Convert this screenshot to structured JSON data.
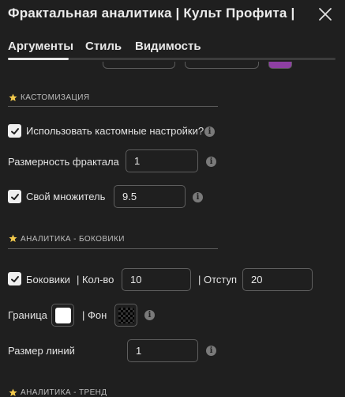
{
  "header": {
    "title": "Фрактальная аналитика | Культ Профита |",
    "close_icon": "close-icon"
  },
  "tabs": [
    {
      "label": "Аргументы",
      "active": true
    },
    {
      "label": "Стиль",
      "active": false
    },
    {
      "label": "Видимость",
      "active": false
    }
  ],
  "colors": {
    "background": "#1f1f1f",
    "accent_star": "#f2c94c",
    "partial_swatch": "#8e3fa3"
  },
  "customization": {
    "section_title": "КАСТОМИЗАЦИЯ",
    "use_custom": {
      "label": "Использовать кастомные настройки?",
      "checked": true
    },
    "fractal_dimension": {
      "label": "Размерность фрактала",
      "value": "1"
    },
    "own_multiplier": {
      "label": "Свой множитель",
      "value": "9.5",
      "checked": true
    }
  },
  "sideways": {
    "section_title": "АНАЛИТИКА - БОКОВИКИ",
    "enabled": {
      "label": "Боковики",
      "checked": true
    },
    "count": {
      "label": "| Кол-во",
      "value": "10"
    },
    "offset": {
      "label": "| Отступ",
      "value": "20"
    },
    "border": {
      "label": "Граница",
      "color": "#ffffff"
    },
    "fill": {
      "label": "| Фон",
      "color": "transparent"
    },
    "line_size": {
      "label": "Размер линий",
      "value": "1"
    }
  },
  "trend": {
    "section_title": "АНАЛИТИКА - ТРЕНД"
  }
}
